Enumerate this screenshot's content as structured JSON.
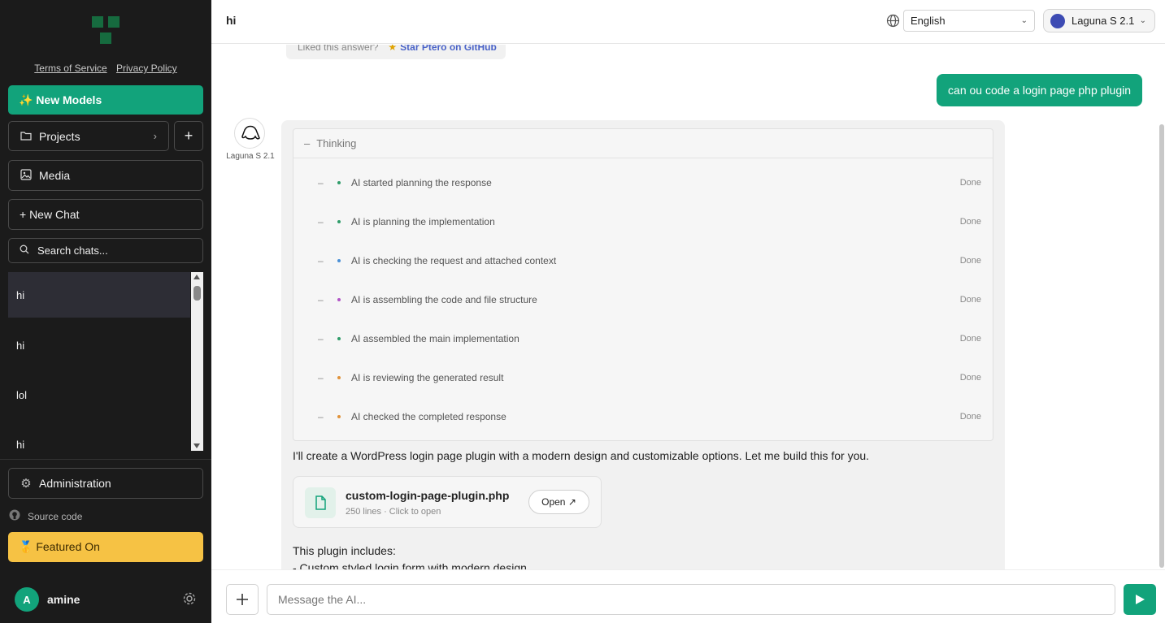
{
  "sidebar": {
    "terms_label": "Terms of Service",
    "privacy_label": "Privacy Policy",
    "new_models_label": "✨ New Models",
    "projects_label": "Projects",
    "add_label": "+",
    "media_label": "Media",
    "new_chat_label": "+ New Chat",
    "search_placeholder": "Search chats...",
    "chats": [
      {
        "title": "hi"
      },
      {
        "title": "hi"
      },
      {
        "title": "lol"
      },
      {
        "title": "hi"
      }
    ],
    "admin_label": "Administration",
    "source_label": "Source code",
    "featured_label": "🥇 Featured On",
    "user": {
      "initial": "A",
      "name": "amine"
    }
  },
  "header": {
    "chat_title": "hi",
    "language": "English",
    "model": "Laguna S 2.1"
  },
  "conversation": {
    "prev_footer_text": "Liked this answer?",
    "prev_footer_link": "Star Ptero on GitHub",
    "user_message": "can ou code a login page php plugin",
    "ai_name": "Laguna S 2.1",
    "thinking_label": "Thinking",
    "steps": [
      {
        "text": "AI started planning the response",
        "status": "Done",
        "color": "#2f9c6a"
      },
      {
        "text": "AI is planning the implementation",
        "status": "Done",
        "color": "#2f9c6a"
      },
      {
        "text": "AI is checking the request and attached context",
        "status": "Done",
        "color": "#4a8fd6"
      },
      {
        "text": "AI is assembling the code and file structure",
        "status": "Done",
        "color": "#b255c7"
      },
      {
        "text": "AI assembled the main implementation",
        "status": "Done",
        "color": "#2f9c6a"
      },
      {
        "text": "AI is reviewing the generated result",
        "status": "Done",
        "color": "#e0923a"
      },
      {
        "text": "AI checked the completed response",
        "status": "Done",
        "color": "#e0923a"
      }
    ],
    "response_text": "I'll create a WordPress login page plugin with a modern design and customizable options. Let me build this for you.",
    "file": {
      "name": "custom-login-page-plugin.php",
      "meta": "250 lines · Click to open",
      "open_label": "Open ↗"
    },
    "includes_label": "This plugin includes:",
    "bullet_1": "- Custom styled login form with modern design"
  },
  "composer": {
    "placeholder": "Message the AI..."
  },
  "colors": {
    "accent": "#12a37b",
    "featured": "#f6c244",
    "sidebar_bg": "#1b1b1b"
  }
}
